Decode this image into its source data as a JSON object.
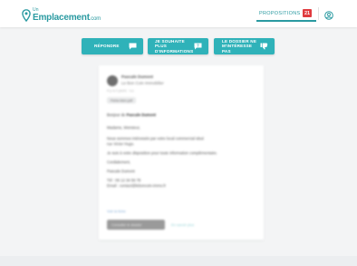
{
  "header": {
    "logo_small": "Un",
    "logo_main": "Emplacement",
    "logo_suffix": ".com",
    "nav_label": "PROPOSITIONS",
    "nav_badge": "21"
  },
  "actions": [
    {
      "label": "RÉPONDRE",
      "icon": "chat-icon"
    },
    {
      "label": "JE SOUHAITE PLUS D'INFORMATIONS",
      "icon": "question-icon"
    },
    {
      "label": "LE DOSSIER NE M'INTÉRESSE PAS",
      "icon": "thumbs-down-icon"
    }
  ],
  "message": {
    "sender_name": "Pascale Dumont",
    "sender_company": "Le Bon Coin Immobilier",
    "meta": "Il y a 2 jours · Lu",
    "attachment": "Fiche-bien.pdf",
    "subject_prefix": "Bonjour de",
    "subject_value": "Pascale Dumont",
    "body": [
      "Madame, Monsieur,",
      "Nous sommes intéressés par votre local commercial situé",
      "rue Victor Hugo.",
      "Je suis à votre disposition pour toute information complémentaire.",
      "Cordialement,",
      "Pascale Dumont",
      "Tél : 06 12 34 56 78",
      "Email : contact@leboncoin-immo.fr"
    ],
    "link": "Voir la fiche",
    "cta": "Consulter le dossier",
    "cta_secondary": "En savoir plus"
  },
  "colors": {
    "accent": "#2fb2b9",
    "badge": "#e03a3e"
  }
}
